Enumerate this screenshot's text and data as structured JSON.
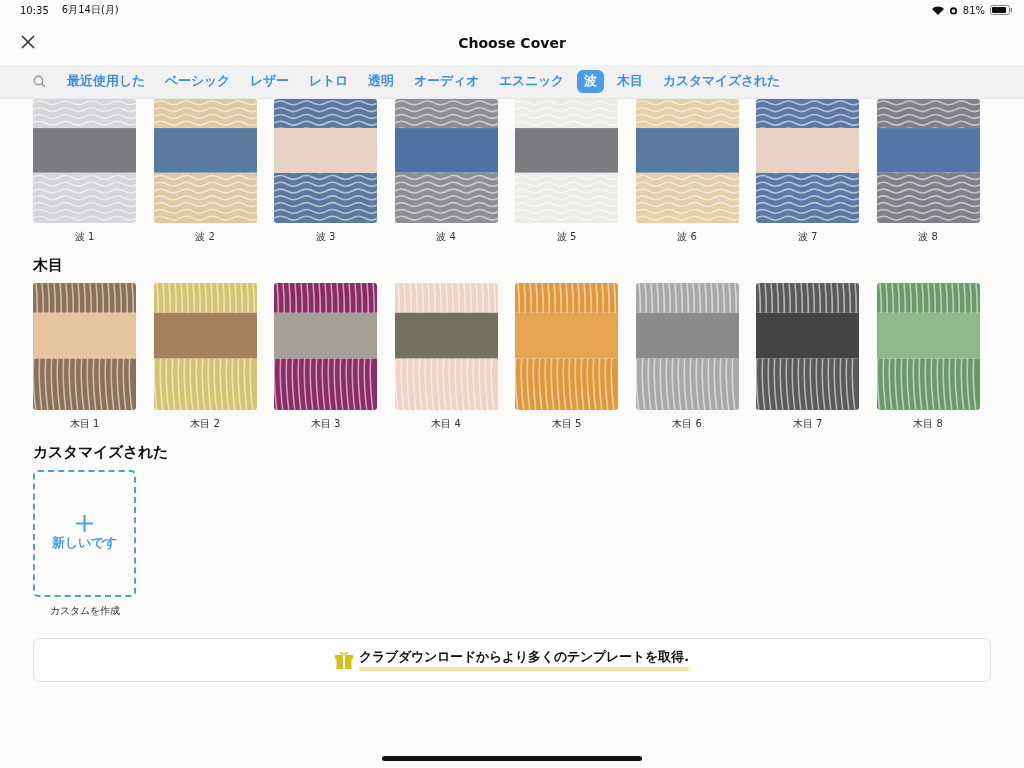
{
  "status_bar": {
    "time": "10:35",
    "date": "6月14日(月)",
    "battery": "81%"
  },
  "header": {
    "title": "Choose Cover"
  },
  "tabs": [
    {
      "label": "最近使用した",
      "selected": false
    },
    {
      "label": "ベーシック",
      "selected": false
    },
    {
      "label": "レザー",
      "selected": false
    },
    {
      "label": "レトロ",
      "selected": false
    },
    {
      "label": "透明",
      "selected": false
    },
    {
      "label": "オーディオ",
      "selected": false
    },
    {
      "label": "エスニック",
      "selected": false
    },
    {
      "label": "波",
      "selected": true
    },
    {
      "label": "木目",
      "selected": false
    },
    {
      "label": "カスタマイズされた",
      "selected": false
    }
  ],
  "sections": [
    {
      "covers": [
        {
          "name": "波 1",
          "kind": "wave",
          "stripes": [
            {
              "color": "#d6d6da"
            },
            {
              "color": "#7c7b80"
            },
            {
              "color": "#d6d6da"
            }
          ]
        },
        {
          "name": "波 2",
          "kind": "wave",
          "stripes": [
            {
              "color": "#dfc9a3"
            },
            {
              "color": "#5a7aa0"
            },
            {
              "color": "#dfc9a3"
            }
          ]
        },
        {
          "name": "波 3",
          "kind": "wave",
          "stripes": [
            {
              "color": "#5a78a0"
            },
            {
              "color": "#e8d2c6"
            },
            {
              "color": "#5a78a0"
            }
          ]
        },
        {
          "name": "波 4",
          "kind": "wave",
          "stripes": [
            {
              "color": "#8e8e94"
            },
            {
              "color": "#4f72a4"
            },
            {
              "color": "#8e8e94"
            }
          ]
        },
        {
          "name": "波 5",
          "kind": "wave",
          "stripes": [
            {
              "color": "#ecebe6"
            },
            {
              "color": "#7c7b80"
            },
            {
              "color": "#ecebe6"
            }
          ]
        },
        {
          "name": "波 6",
          "kind": "wave",
          "stripes": [
            {
              "color": "#e4cfa8"
            },
            {
              "color": "#5a7aa0"
            },
            {
              "color": "#e4cfa8"
            }
          ]
        },
        {
          "name": "波 7",
          "kind": "wave",
          "stripes": [
            {
              "color": "#5d78a4"
            },
            {
              "color": "#e8d2c6"
            },
            {
              "color": "#5d78a4"
            }
          ]
        },
        {
          "name": "波 8",
          "kind": "wave",
          "stripes": [
            {
              "color": "#808088"
            },
            {
              "color": "#5476a8"
            },
            {
              "color": "#808088"
            }
          ]
        }
      ]
    },
    {
      "title": "木目",
      "covers": [
        {
          "name": "木目 1",
          "kind": "wood",
          "stripes": [
            {
              "color": "#8c7058"
            },
            {
              "color": "#e6c4a0"
            },
            {
              "color": "#8c7058"
            }
          ]
        },
        {
          "name": "木目 2",
          "kind": "wood",
          "stripes": [
            {
              "color": "#d4c470"
            },
            {
              "color": "#a4805c"
            },
            {
              "color": "#d4c470"
            }
          ]
        },
        {
          "name": "木目 3",
          "kind": "wood",
          "stripes": [
            {
              "color": "#8a2c64"
            },
            {
              "color": "#a4a096"
            },
            {
              "color": "#8a2c64"
            }
          ]
        },
        {
          "name": "木目 4",
          "kind": "wood",
          "stripes": [
            {
              "color": "#eed4c6"
            },
            {
              "color": "#747060"
            },
            {
              "color": "#eed4c6"
            }
          ]
        },
        {
          "name": "木目 5",
          "kind": "wood",
          "stripes": [
            {
              "color": "#e0983c"
            },
            {
              "color": "#e8a450"
            },
            {
              "color": "#e0983c"
            }
          ]
        },
        {
          "name": "木目 6",
          "kind": "wood",
          "stripes": [
            {
              "color": "#a8a8a8"
            },
            {
              "color": "#8a8a88"
            },
            {
              "color": "#a8a8a8"
            }
          ]
        },
        {
          "name": "木目 7",
          "kind": "wood",
          "stripes": [
            {
              "color": "#5a5a5a"
            },
            {
              "color": "#444444"
            },
            {
              "color": "#5a5a5a"
            }
          ]
        },
        {
          "name": "木目 8",
          "kind": "wood",
          "stripes": [
            {
              "color": "#6a9a6c"
            },
            {
              "color": "#8cba8c"
            },
            {
              "color": "#6a9a6c"
            }
          ]
        }
      ]
    },
    {
      "title": "カスタマイズされた",
      "covers": [
        {
          "kind": "new",
          "button": "新しいです",
          "name": "カスタムを作成"
        }
      ]
    }
  ],
  "banner": {
    "text": "クラブダウンロードからより多くのテンプレートを取得."
  }
}
